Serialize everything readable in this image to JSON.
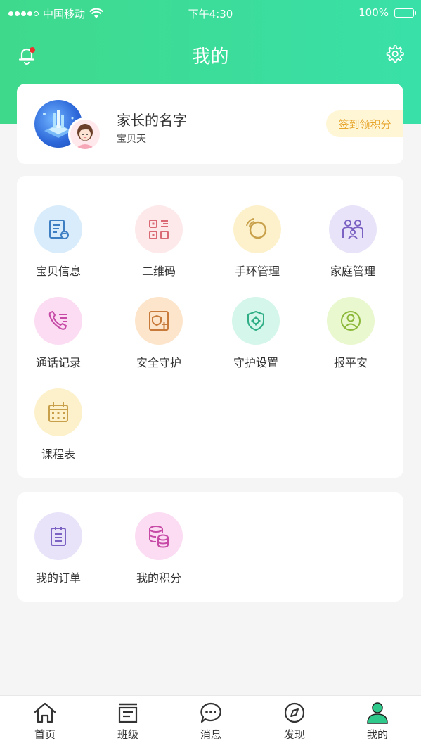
{
  "status_bar": {
    "carrier": "中国移动",
    "time": "下午4:30",
    "battery": "100%"
  },
  "header": {
    "title": "我的",
    "left_icon": "bell-icon",
    "right_icon": "gear-icon",
    "accent_color": "#3fd98c"
  },
  "profile": {
    "parent_name": "家长的名字",
    "child_name": "宝贝天",
    "checkin_label": "签到领积分"
  },
  "menu": {
    "items": [
      {
        "label": "宝贝信息",
        "icon": "baby-info-icon",
        "bg": "#d8ecfb"
      },
      {
        "label": "二维码",
        "icon": "qr-code-icon",
        "bg": "#fde8ea"
      },
      {
        "label": "手环管理",
        "icon": "bracelet-icon",
        "bg": "#fdf1cc"
      },
      {
        "label": "家庭管理",
        "icon": "family-icon",
        "bg": "#e8e3f9"
      },
      {
        "label": "通话记录",
        "icon": "call-log-icon",
        "bg": "#fbdcf3"
      },
      {
        "label": "安全守护",
        "icon": "safety-icon",
        "bg": "#fde5cc"
      },
      {
        "label": "守护设置",
        "icon": "guard-settings-icon",
        "bg": "#d5f6ea"
      },
      {
        "label": "报平安",
        "icon": "report-safe-icon",
        "bg": "#eaf8cf"
      },
      {
        "label": "课程表",
        "icon": "schedule-icon",
        "bg": "#fdf1cc"
      }
    ]
  },
  "orders": {
    "items": [
      {
        "label": "我的订单",
        "icon": "orders-icon",
        "bg": "#e8e3f9"
      },
      {
        "label": "我的积分",
        "icon": "points-icon",
        "bg": "#fbdcf3"
      }
    ]
  },
  "tabbar": {
    "items": [
      {
        "label": "首页",
        "icon": "home-icon"
      },
      {
        "label": "班级",
        "icon": "class-icon"
      },
      {
        "label": "消息",
        "icon": "message-icon"
      },
      {
        "label": "发现",
        "icon": "compass-icon"
      },
      {
        "label": "我的",
        "icon": "user-icon",
        "active": true
      }
    ]
  }
}
